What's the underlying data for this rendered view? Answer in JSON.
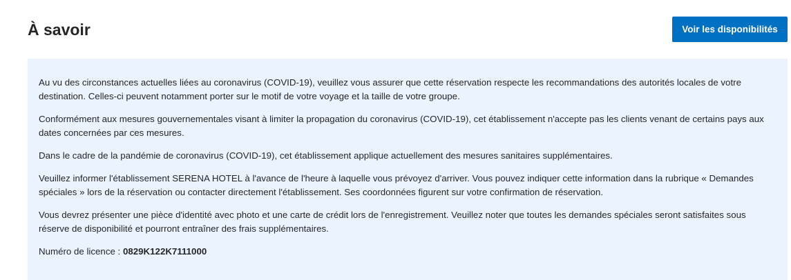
{
  "header": {
    "title": "À savoir",
    "cta_label": "Voir les disponibilités"
  },
  "notice": {
    "paragraphs": [
      "Au vu des circonstances actuelles liées au coronavirus (COVID-19), veuillez vous assurer que cette réservation respecte les recommandations des autorités locales de votre destination. Celles-ci peuvent notamment porter sur le motif de votre voyage et la taille de votre groupe.",
      "Conformément aux mesures gouvernementales visant à limiter la propagation du coronavirus (COVID-19), cet établissement n'accepte pas les clients venant de certains pays aux dates concernées par ces mesures.",
      "Dans le cadre de la pandémie de coronavirus (COVID-19), cet établissement applique actuellement des mesures sanitaires supplémentaires.",
      "Veuillez informer l'établissement SERENA HOTEL à l'avance de l'heure à laquelle vous prévoyez d'arriver. Vous pouvez indiquer cette information dans la rubrique « Demandes spéciales » lors de la réservation ou contacter directement l'établissement. Ses coordonnées figurent sur votre confirmation de réservation.",
      "Vous devrez présenter une pièce d'identité avec photo et une carte de crédit lors de l'enregistrement. Veuillez noter que toutes les demandes spéciales seront satisfaites sous réserve de disponibilité et pourront entraîner des frais supplémentaires."
    ],
    "license_label": "Numéro de licence :",
    "license_number": "0829K122K7111000"
  },
  "colors": {
    "primary_button": "#0071c2",
    "panel_background": "#ebf3ff",
    "text": "#262626"
  }
}
